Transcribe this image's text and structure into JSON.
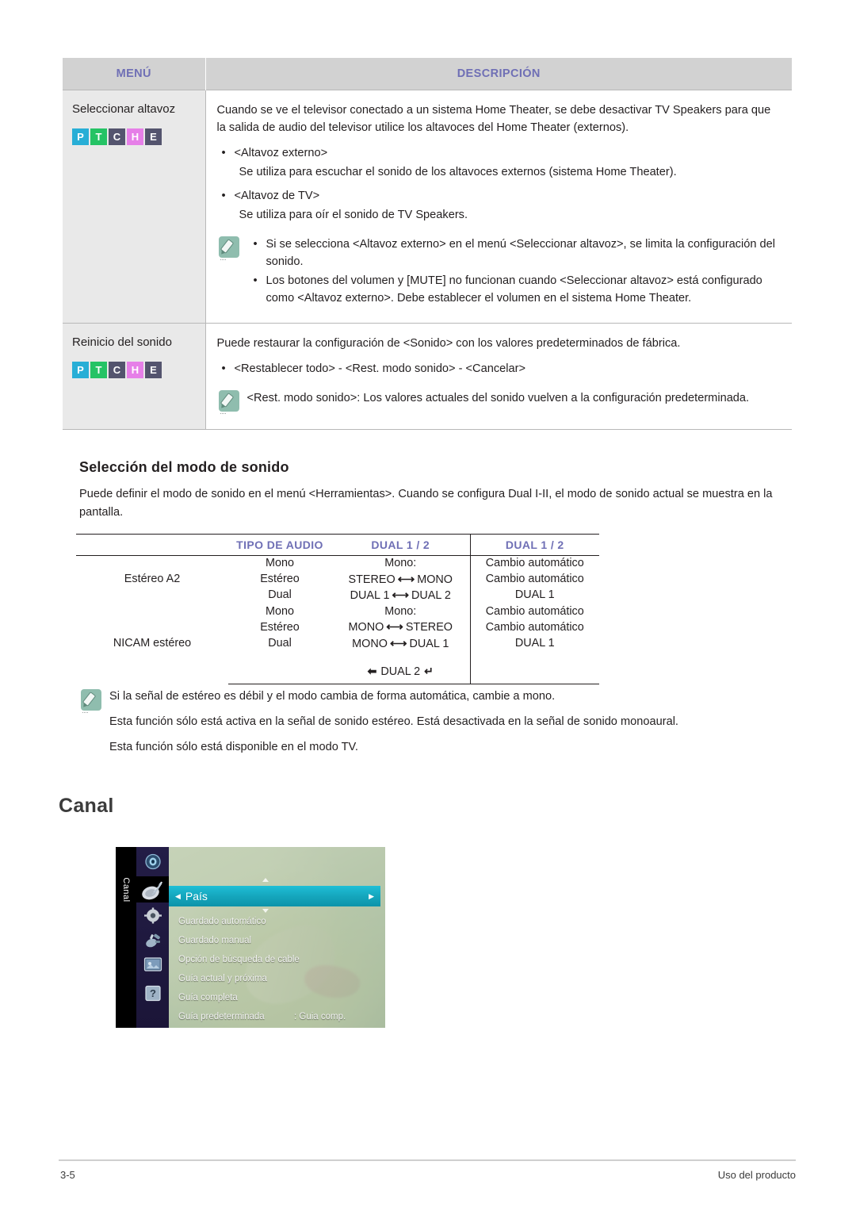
{
  "menu_table": {
    "headers": {
      "menu": "MENÚ",
      "description": "DESCRIPCIÓN"
    },
    "header_bg": "#d2d2d2",
    "header_text_color": "#6f6fb5",
    "rows": [
      {
        "label": "Seleccionar altavoz",
        "badges": [
          {
            "letter": "P",
            "color": "#28aed6"
          },
          {
            "letter": "T",
            "color": "#25c365"
          },
          {
            "letter": "C",
            "color": "#54546e"
          },
          {
            "letter": "H",
            "color": "#e67fe8"
          },
          {
            "letter": "E",
            "color": "#54546e"
          }
        ],
        "intro": "Cuando se ve el televisor conectado a un sistema Home Theater, se debe desactivar TV Speakers para que la salida de audio del televisor utilice los altavoces del Home Theater (externos).",
        "bullets": [
          {
            "title": "<Altavoz externo>",
            "sub": "Se utiliza para escuchar el sonido de los altavoces externos (sistema Home Theater)."
          },
          {
            "title": "<Altavoz de TV>",
            "sub": "Se utiliza para oír el sonido de TV Speakers."
          }
        ],
        "note_bullets": [
          "Si se selecciona <Altavoz externo> en el menú <Seleccionar altavoz>, se limita la configuración del sonido.",
          "Los botones del volumen y [MUTE] no funcionan cuando <Seleccionar altavoz> está configurado como <Altavoz externo>. Debe establecer el volumen en el sistema Home Theater."
        ],
        "bullet_char": "•"
      },
      {
        "label": "Reinicio del sonido",
        "badges": [
          {
            "letter": "P",
            "color": "#28aed6"
          },
          {
            "letter": "T",
            "color": "#25c365"
          },
          {
            "letter": "C",
            "color": "#54546e"
          },
          {
            "letter": "H",
            "color": "#e67fe8"
          },
          {
            "letter": "E",
            "color": "#54546e"
          }
        ],
        "intro": "Puede restaurar la configuración de <Sonido> con los valores predeterminados de fábrica.",
        "bullet_one": "<Restablecer todo> - <Rest. modo sonido> - <Cancelar>",
        "note_plain": "<Rest. modo sonido>: Los valores actuales del sonido vuelven a la configuración predeterminada.",
        "bullet_char": "•"
      }
    ]
  },
  "sound_mode_section": {
    "heading": "Selección del modo de sonido",
    "intro": "Puede definir el modo de sonido en el menú <Herramientas>. Cuando se configura Dual I-II, el modo de sonido actual se muestra en la pantalla."
  },
  "audio_table": {
    "headers": {
      "col1": "",
      "col2": "TIPO DE AUDIO",
      "col3": "DUAL 1 / 2",
      "col4": "DUAL 1 / 2"
    },
    "header_text_color": "#6f6fb5",
    "groups": [
      {
        "name": "Estéreo A2",
        "rows": [
          {
            "type": "Mono",
            "dual_left": "Mono:",
            "dual_right": "Cambio automático",
            "arrow": false
          },
          {
            "type": "Estéreo",
            "left": "STEREO",
            "right": "MONO",
            "dual_right": "Cambio automático",
            "arrow": true
          },
          {
            "type": "Dual",
            "left": "DUAL 1",
            "right": "DUAL 2",
            "dual_right": "DUAL 1",
            "arrow": true
          }
        ]
      },
      {
        "name": "NICAM estéreo",
        "rows": [
          {
            "type": "Mono",
            "dual_left": "Mono:",
            "dual_right": "Cambio automático",
            "arrow": false
          },
          {
            "type": "Estéreo",
            "left": "MONO",
            "right": "STEREO",
            "dual_right": "Cambio automático",
            "arrow": true
          },
          {
            "type": "Dual",
            "left": "MONO",
            "right": "DUAL 1",
            "dual_right": "DUAL 1",
            "arrow": true
          }
        ],
        "extra_row": {
          "label": "DUAL 2",
          "hook_left": "�ives",
          "hook_right": "↵"
        }
      }
    ],
    "arrow_glyph": "⟷"
  },
  "audio_notes": [
    "Si la señal de estéreo es débil y el modo cambia de forma automática, cambie a mono.",
    "Esta función sólo está activa en la señal de sonido estéreo. Está desactivada en la señal de sonido monoaural.",
    "Esta función sólo está disponible en el modo TV."
  ],
  "canal_section": {
    "heading": "Canal",
    "tv_menu": {
      "vertical_label": "Canal",
      "sidebar_icons": [
        {
          "name": "sound-icon"
        },
        {
          "name": "satellite-dish-icon"
        },
        {
          "name": "settings-gear-icon"
        },
        {
          "name": "network-plug-icon"
        },
        {
          "name": "media-picture-icon"
        },
        {
          "name": "help-question-icon"
        }
      ],
      "selected_item": "País",
      "selected_bg": "#15a6bd",
      "items": [
        {
          "label": "Guardado automático",
          "value": ""
        },
        {
          "label": "Guardado manual",
          "value": ""
        },
        {
          "label": "Opción de búsqueda de cable",
          "value": ""
        },
        {
          "label": "Guía actual y próxima",
          "value": ""
        },
        {
          "label": "Guía completa",
          "value": ""
        },
        {
          "label": "Guía predeterminada",
          "value": ": Guia comp."
        }
      ]
    }
  },
  "footer": {
    "page_number": "3-5",
    "section_title": "Uso del producto"
  }
}
